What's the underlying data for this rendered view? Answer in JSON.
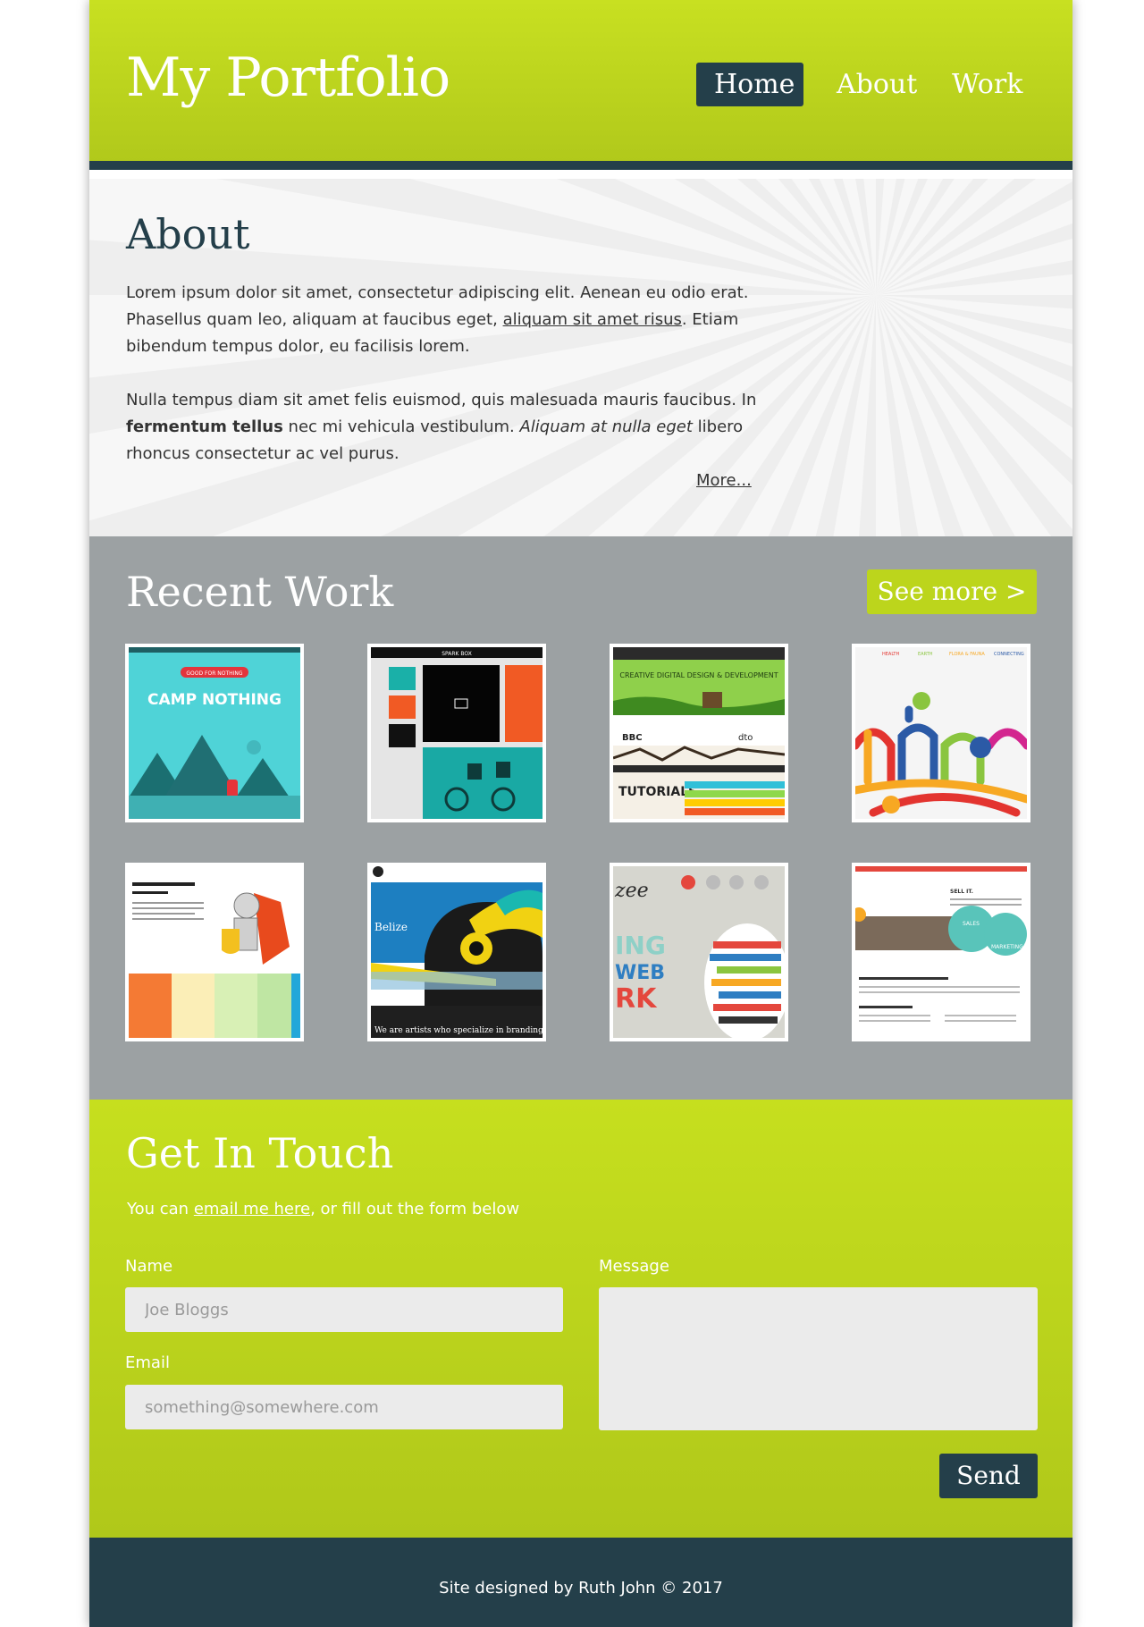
{
  "header": {
    "logo": "My Portfolio",
    "nav": [
      {
        "label": "Home",
        "active": true
      },
      {
        "label": "About",
        "active": false
      },
      {
        "label": "Work",
        "active": false
      }
    ]
  },
  "about": {
    "title": "About",
    "p1_before": "Lorem ipsum dolor sit amet, consectetur adipiscing elit. Aenean eu odio erat. Phasellus quam leo, aliquam at faucibus eget, ",
    "p1_link": "aliquam sit amet risus",
    "p1_after": ". Etiam bibendum tempus dolor, eu facilisis lorem.",
    "p2_before": "Nulla tempus diam sit amet felis euismod, quis malesuada mauris faucibus. In ",
    "p2_strong": "fermentum tellus",
    "p2_middle": " nec mi vehicula vestibulum. ",
    "p2_em": "Aliquam at nulla eget",
    "p2_after": " libero rhoncus consectetur ac vel purus.",
    "more_link": "More..."
  },
  "work": {
    "title": "Recent Work",
    "see_more": "See more >",
    "thumbs": [
      {
        "name": "camp-nothing",
        "badge": "GOOD FOR NOTHING",
        "caption": "CAMP NOTHING"
      },
      {
        "name": "spark-box",
        "caption": "SPARK BOX"
      },
      {
        "name": "creative-digital",
        "headline": "CREATIVE DIGITAL DESIGN & DEVELOPMENT",
        "caption": "TUTORIALS"
      },
      {
        "name": "colourful-lines",
        "nav": [
          "HEALTH",
          "EARTH",
          "FLORA & FAUNA",
          "CONNECTING"
        ]
      },
      {
        "name": "knight-pricing"
      },
      {
        "name": "belize-toucan",
        "caption": "Belize",
        "tagline": "We are artists who specialize in branding"
      },
      {
        "name": "typography",
        "caption": "zee",
        "words": [
          "ING",
          "WEB",
          "RK"
        ]
      },
      {
        "name": "sales-marketing",
        "labels": [
          "SELL IT.",
          "SALES",
          "MARKETING"
        ]
      }
    ]
  },
  "contact": {
    "title": "Get In Touch",
    "intro_before": "You can ",
    "intro_link": "email me here",
    "intro_after": ", or fill out the form below",
    "name_label": "Name",
    "name_placeholder": "Joe Bloggs",
    "email_label": "Email",
    "email_placeholder": "something@somewhere.com",
    "message_label": "Message",
    "send": "Send"
  },
  "footer": {
    "text": "Site designed by Ruth John © 2017"
  },
  "colors": {
    "lime": "#c3dc1e",
    "dark": "#243f4a",
    "grey": "#9ca1a3"
  }
}
